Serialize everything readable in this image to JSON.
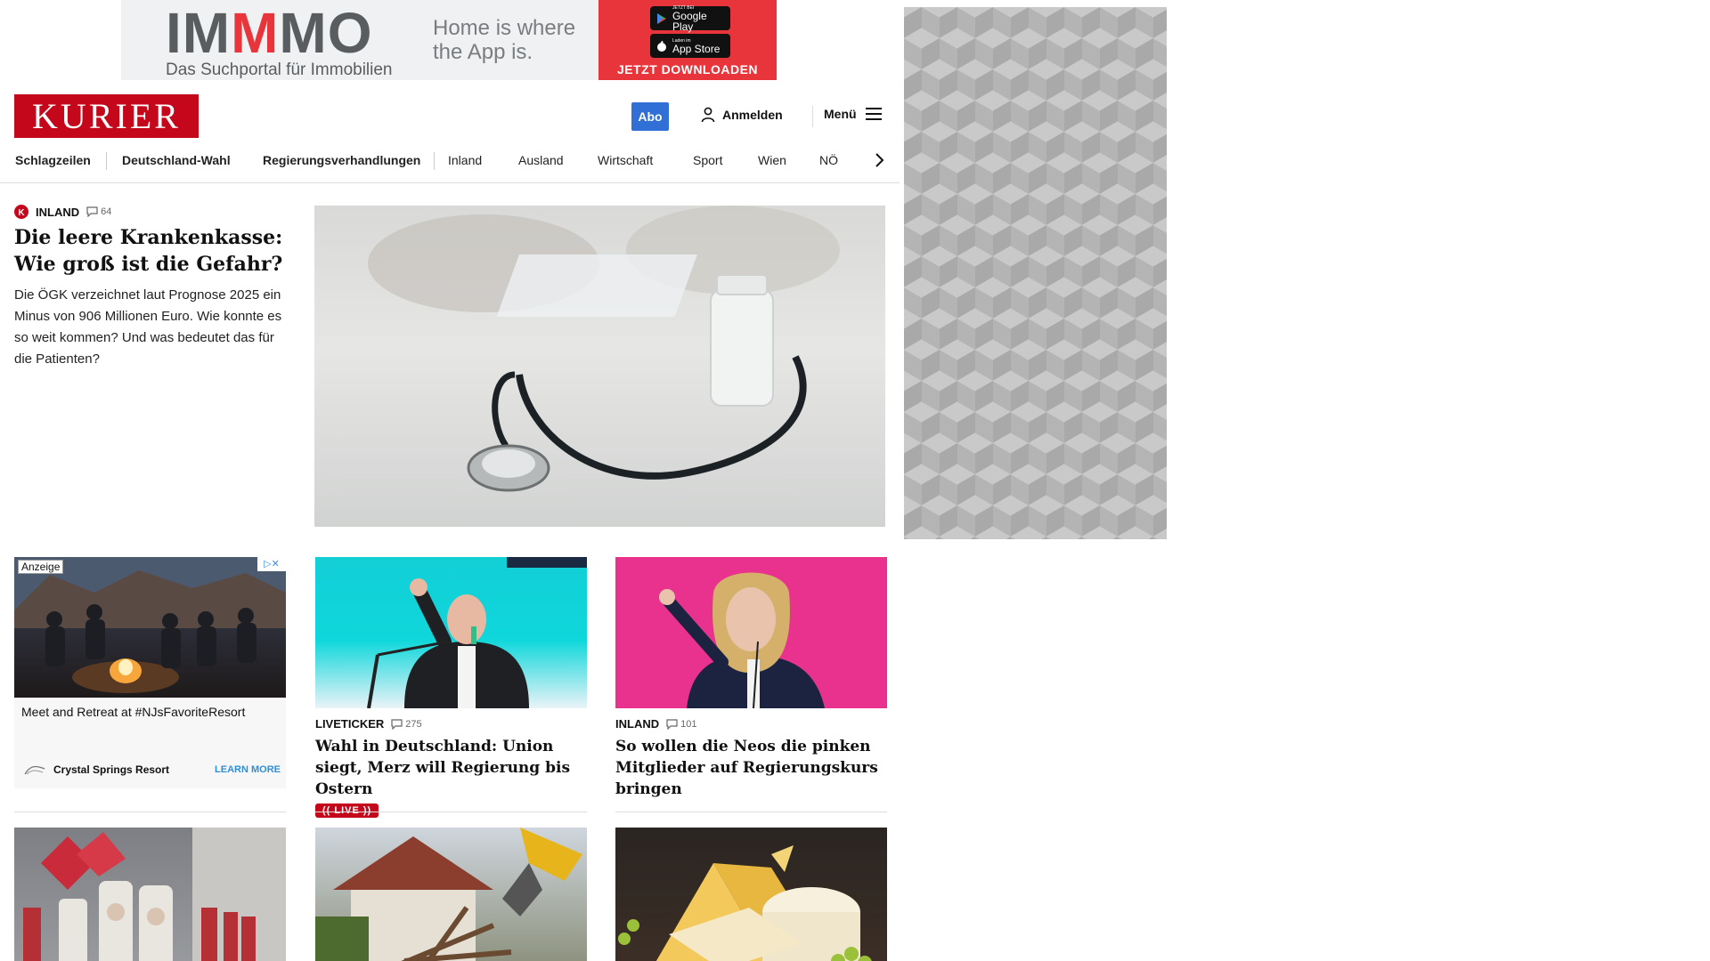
{
  "top_ad": {
    "logo": "IMMMO",
    "tagline": "Das Suchportal für Immobilien",
    "slogan": "Home is where the App is.",
    "google_play_small": "JETZT BEI",
    "google_play": "Google Play",
    "app_store_small": "Laden im",
    "app_store": "App Store",
    "cta": "JETZT DOWNLOADEN",
    "accent": "#e8353b"
  },
  "header": {
    "logo": "KURIER",
    "abo": "Abo",
    "login": "Anmelden",
    "menu": "Menü",
    "brand_color": "#c4071b",
    "abo_color": "#2f6fd6"
  },
  "nav": {
    "items": [
      "Schlagzeilen",
      "Deutschland-Wahl",
      "Regierungsverhandlungen",
      "Inland",
      "Ausland",
      "Wirtschaft",
      "Sport",
      "Wien",
      "NÖ"
    ]
  },
  "lead": {
    "section": "INLAND",
    "comments": "64",
    "title": "Die leere Krankenkasse: Wie groß ist die Gefahr?",
    "teaser": "Die ÖGK verzeichnet laut Prognose 2025 ein Minus von 906 Millionen Euro. Wie konnte es so weit kommen? Und was bedeutet das für die Patienten?"
  },
  "ad_card": {
    "label": "Anzeige",
    "text": "Meet and Retreat at #NJsFavoriteResort",
    "advertiser": "Crystal Springs Resort",
    "cta": "LEARN MORE"
  },
  "cards": [
    {
      "section": "LIVETICKER",
      "comments": "275",
      "title": "Wahl in Deutschland: Union siegt, Merz will Regierung bis Ostern",
      "badge": "(( LIVE ))"
    },
    {
      "section": "INLAND",
      "comments": "101",
      "title": "So wollen die Neos die pinken Mitglieder auf Regierungskurs bringen"
    }
  ]
}
